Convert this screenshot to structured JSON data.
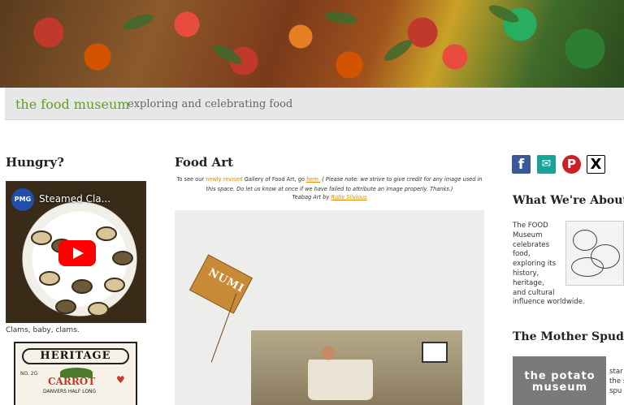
{
  "site": {
    "name": "the food museum",
    "tagline": "exploring and celebrating food"
  },
  "left": {
    "heading": "Hungry?",
    "video": {
      "channel_badge": "PMG",
      "title": "Steamed Cla...",
      "caption": "Clams, baby, clams."
    },
    "seed_packet": {
      "brand": "HERITAGE",
      "number": "NO. 2G",
      "variety_name": "CARROT",
      "variety_sub": "DANVERS HALF LONG"
    }
  },
  "main": {
    "title": "Food Art",
    "intro_prefix": "To see our ",
    "intro_highlight": "newly revised",
    "intro_middle": " Gallery of Food Art, go ",
    "intro_link": "here.",
    "intro_note": " ( Please note: we strive to give credit for any image used in this space. Do let us know at once if we have failed to attribute an image properly. Thanks.)",
    "credit_prefix": "Teabag Art by ",
    "credit_link": "Ruby Silvious",
    "teabag_brand": "NUMI"
  },
  "right": {
    "social": [
      {
        "name": "facebook-icon",
        "glyph": "f"
      },
      {
        "name": "email-icon",
        "glyph": "✉"
      },
      {
        "name": "pinterest-icon",
        "glyph": "P"
      },
      {
        "name": "x-icon",
        "glyph": "X"
      }
    ],
    "about_heading": "What We're About",
    "about_lines": [
      "The FOOD",
      "Museum",
      "celebrates",
      "food,",
      "exploring its",
      "history,",
      "heritage,",
      "and cultural",
      "influence worldwide."
    ],
    "spud_heading": "The Mother Spud",
    "spud_logo_text": "the potato museum",
    "spud_snippet": [
      "star",
      "the s",
      "spu"
    ]
  },
  "colors": {
    "brand_green": "#5aa31c",
    "link_orange": "#e08a00",
    "titlebar_bg": "#e7e7e7"
  }
}
